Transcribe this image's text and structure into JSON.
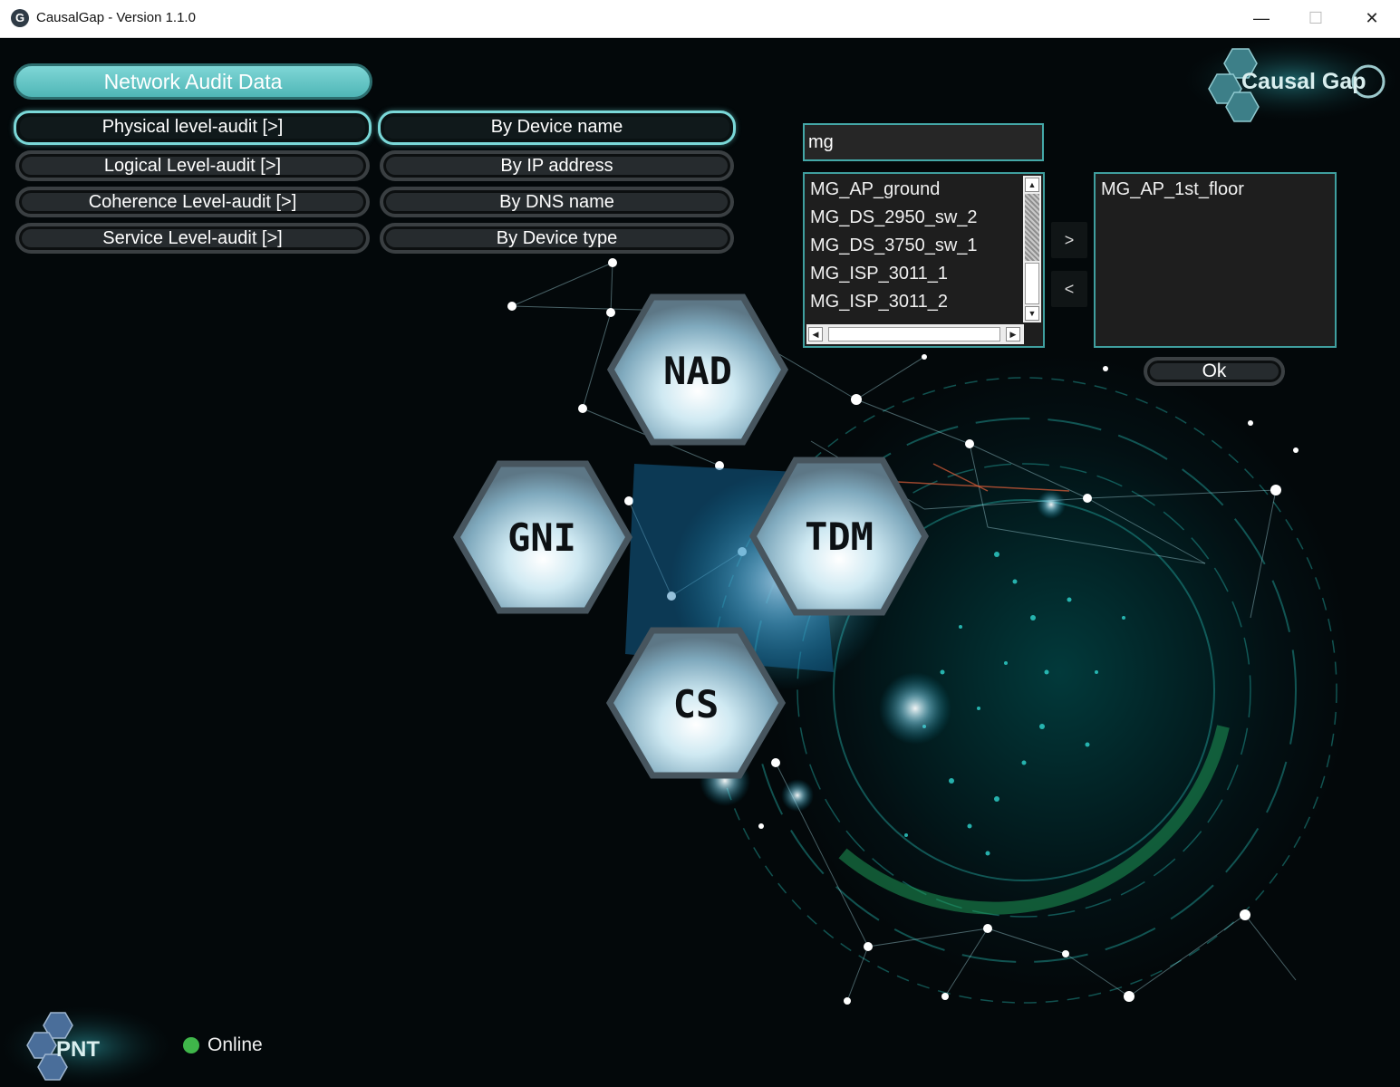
{
  "window": {
    "title": "CausalGap - Version 1.1.0",
    "app_icon": "G",
    "controls": {
      "minimize": "—",
      "maximize": "☐",
      "close": "✕"
    }
  },
  "brand": {
    "logo_text": "Causal Gap",
    "footer_logo_text": "PNT"
  },
  "header": {
    "label": "Network Audit Data"
  },
  "audit_levels": [
    {
      "label": "Physical level-audit [>]",
      "active": true
    },
    {
      "label": "Logical Level-audit [>]",
      "active": false
    },
    {
      "label": "Coherence Level-audit [>]",
      "active": false
    },
    {
      "label": "Service Level-audit [>]",
      "active": false
    }
  ],
  "filters": [
    {
      "label": "By Device name",
      "active": true
    },
    {
      "label": "By IP address",
      "active": false
    },
    {
      "label": "By DNS name",
      "active": false
    },
    {
      "label": "By Device type",
      "active": false
    }
  ],
  "search": {
    "value": "mg"
  },
  "available_devices": [
    "MG_AP_ground",
    "MG_DS_2950_sw_2",
    "MG_DS_3750_sw_1",
    "MG_ISP_3011_1",
    "MG_ISP_3011_2"
  ],
  "selected_devices": [
    "MG_AP_1st_floor"
  ],
  "transfer": {
    "add_label": ">",
    "remove_label": "<"
  },
  "ok_label": "Ok",
  "modules": {
    "nad": "NAD",
    "gni": "GNI",
    "tdm": "TDM",
    "cs": "CS"
  },
  "status": {
    "label": "Online",
    "color": "#3fb64a"
  },
  "colors": {
    "accent": "#7ad8d8",
    "header_fill": "#5fc4c4",
    "background": "#03080a"
  }
}
